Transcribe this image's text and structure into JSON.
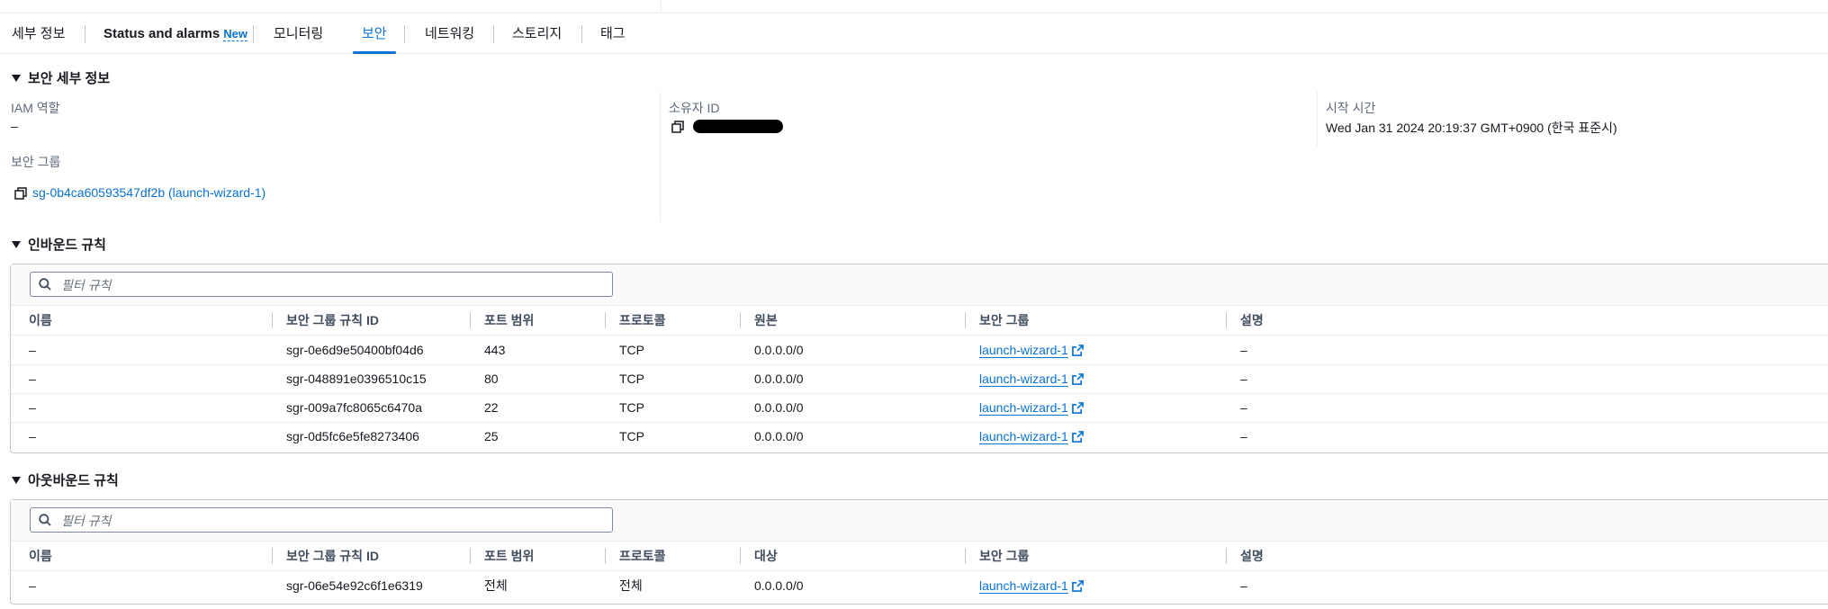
{
  "tabs": [
    {
      "label": "세부 정보"
    },
    {
      "label": "Status and alarms",
      "badge": "New"
    },
    {
      "label": "모니터링"
    },
    {
      "label": "보안"
    },
    {
      "label": "네트워킹"
    },
    {
      "label": "스토리지"
    },
    {
      "label": "태그"
    }
  ],
  "security_details": {
    "heading": "보안 세부 정보",
    "iam_role_label": "IAM 역할",
    "iam_role_value": "–",
    "owner_id_label": "소유자 ID",
    "start_time_label": "시작 시간",
    "start_time_value": "Wed Jan 31 2024 20:19:37 GMT+0900 (한국 표준시)",
    "security_groups_label": "보안 그룹",
    "security_group_link": "sg-0b4ca60593547df2b (launch-wizard-1)"
  },
  "inbound": {
    "heading": "인바운드 규칙",
    "search_placeholder": "필터 규칙",
    "columns": [
      "이름",
      "보안 그룹 규칙 ID",
      "포트 범위",
      "프로토콜",
      "원본",
      "보안 그룹",
      "설명"
    ],
    "rows": [
      {
        "name": "–",
        "rule_id": "sgr-0e6d9e50400bf04d6",
        "port": "443",
        "protocol": "TCP",
        "source": "0.0.0.0/0",
        "sg": "launch-wizard-1",
        "desc": "–"
      },
      {
        "name": "–",
        "rule_id": "sgr-048891e0396510c15",
        "port": "80",
        "protocol": "TCP",
        "source": "0.0.0.0/0",
        "sg": "launch-wizard-1",
        "desc": "–"
      },
      {
        "name": "–",
        "rule_id": "sgr-009a7fc8065c6470a",
        "port": "22",
        "protocol": "TCP",
        "source": "0.0.0.0/0",
        "sg": "launch-wizard-1",
        "desc": "–"
      },
      {
        "name": "–",
        "rule_id": "sgr-0d5fc6e5fe8273406",
        "port": "25",
        "protocol": "TCP",
        "source": "0.0.0.0/0",
        "sg": "launch-wizard-1",
        "desc": "–"
      }
    ]
  },
  "outbound": {
    "heading": "아웃바운드 규칙",
    "search_placeholder": "필터 규칙",
    "columns": [
      "이름",
      "보안 그룹 규칙 ID",
      "포트 범위",
      "프로토콜",
      "대상",
      "보안 그룹",
      "설명"
    ],
    "rows": [
      {
        "name": "–",
        "rule_id": "sgr-06e54e92c6f1e6319",
        "port": "전체",
        "protocol": "전체",
        "destination": "0.0.0.0/0",
        "sg": "launch-wizard-1",
        "desc": "–"
      }
    ]
  },
  "colors": {
    "accent": "#0972d3",
    "text": "#16191f",
    "label": "#5f6b7a",
    "border": "#e9ebed"
  },
  "icons": {
    "caret": "caret-down-icon",
    "copy": "copy-icon",
    "search": "search-icon",
    "external": "external-link-icon"
  }
}
